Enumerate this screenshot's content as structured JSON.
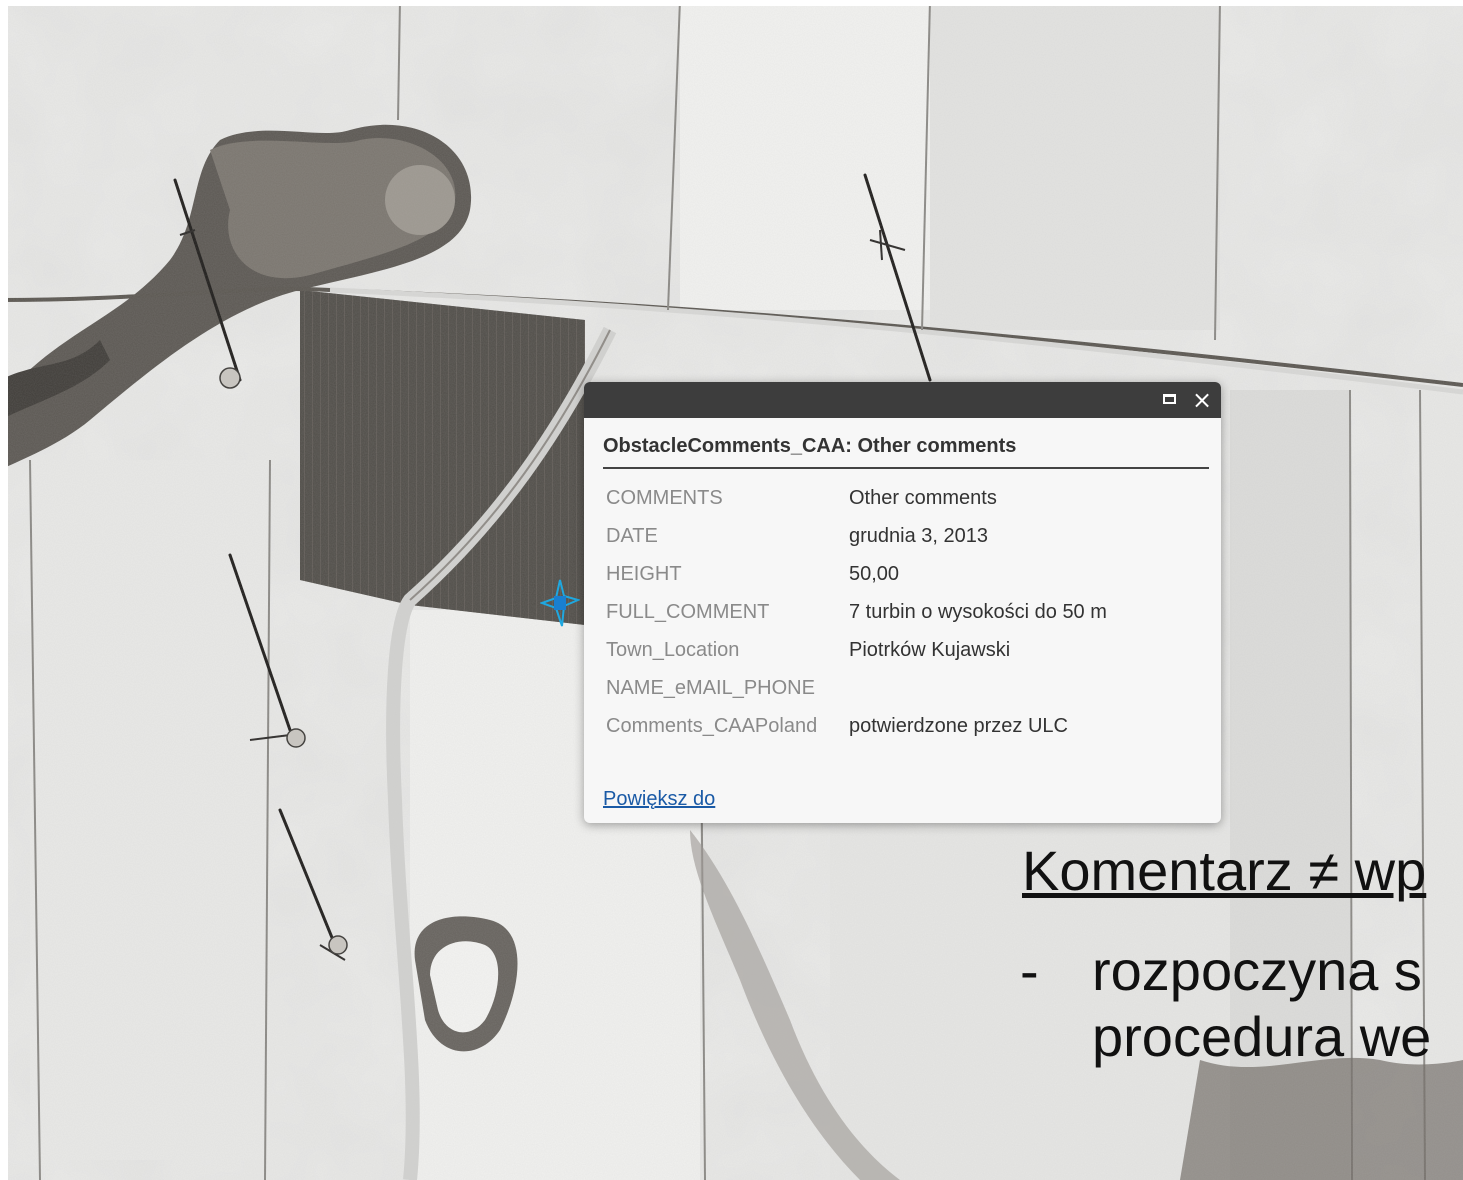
{
  "popup": {
    "title": "ObstacleComments_CAA: Other comments",
    "rows": [
      {
        "key": "COMMENTS",
        "value": "Other comments"
      },
      {
        "key": "DATE",
        "value": "grudnia 3, 2013"
      },
      {
        "key": "HEIGHT",
        "value": "50,00"
      },
      {
        "key": "FULL_COMMENT",
        "value": "7 turbin o wysokości do 50 m"
      },
      {
        "key": "Town_Location",
        "value": "Piotrków Kujawski"
      },
      {
        "key": "NAME_eMAIL_PHONE",
        "value": ""
      },
      {
        "key": "Comments_CAAPoland",
        "value": "potwierdzone przez ULC"
      }
    ],
    "zoom_label": "Powiększ do",
    "maximize_icon": "maximize-icon",
    "close_icon": "close-icon"
  },
  "slide": {
    "heading": "Komentarz ≠ wp",
    "bullet_dash": "-",
    "bullet_line1": "rozpoczyna s",
    "bullet_line2": "procedura we"
  },
  "colors": {
    "popup_header": "#3d3d3d",
    "link": "#1a5aa6",
    "marker": "#1fa8e0"
  }
}
